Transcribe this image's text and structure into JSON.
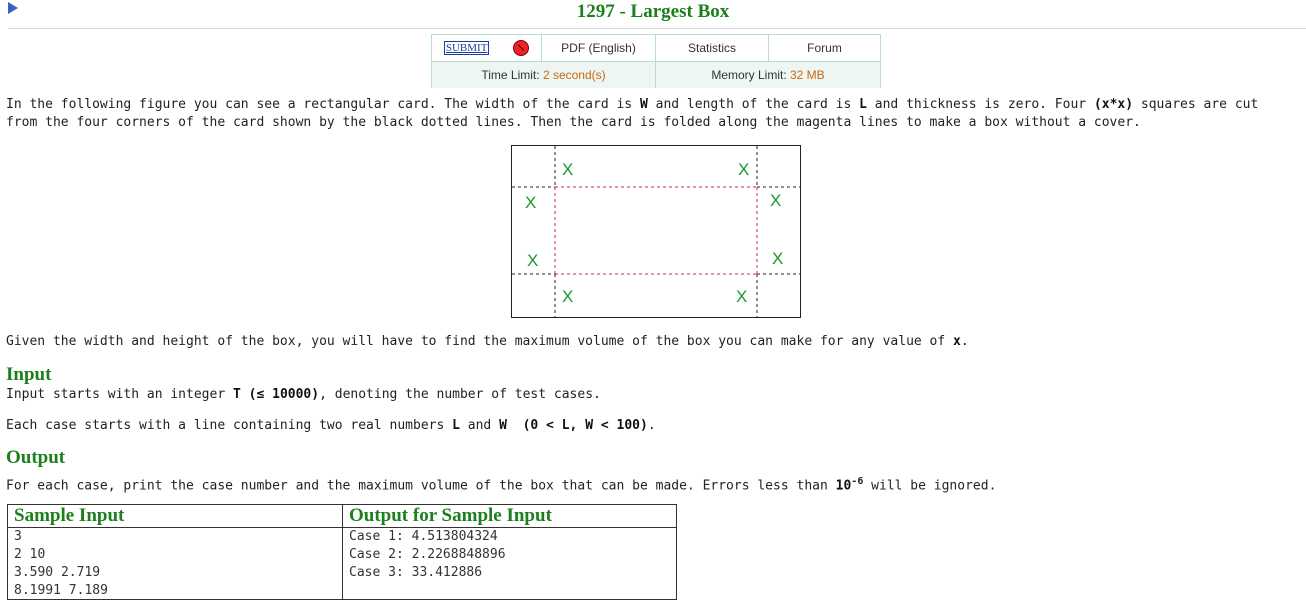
{
  "problem": {
    "title": "1297 - Largest Box"
  },
  "info_table": {
    "submit_label": "SUBMIT",
    "pdf_label": "PDF (English)",
    "statistics_label": "Statistics",
    "forum_label": "Forum",
    "time_limit_label": "Time Limit:",
    "time_limit_value": "2 second(s)",
    "memory_limit_label": "Memory Limit:",
    "memory_limit_value": "32 MB"
  },
  "statement": {
    "p1_a": "In the following figure you can see a rectangular card. The width of the card is ",
    "p1_W": "W",
    "p1_b": " and length of the card is ",
    "p1_L": "L",
    "p1_c": " and thickness is zero. Four ",
    "p1_x": "(x*x)",
    "p1_d": " squares are cut",
    "p1_line2": "from the four corners of the card shown by the black dotted lines. Then the card is folded along the magenta lines to make a box without a cover.",
    "p2_a": "Given the width and height of the box, you will have to find the maximum volume of the box you can make for any value of ",
    "p2_x": "x",
    "p2_b": "."
  },
  "figure": {
    "marks": [
      "X",
      "X",
      "X",
      "X",
      "X",
      "X",
      "X",
      "X"
    ]
  },
  "input_section": {
    "heading": "Input",
    "line1_a": "Input starts with an integer ",
    "line1_T": "T",
    "line1_b": " (",
    "line1_le": "≤",
    "line1_c": " 10000)",
    "line1_d": ", denoting the number of test cases.",
    "line2_a": "Each case starts with a line containing two real numbers ",
    "line2_L": "L",
    "line2_b": " and ",
    "line2_W": "W",
    "line2_c": " (0 < L, W < 100)",
    "line2_d": "."
  },
  "output_section": {
    "heading": "Output",
    "line1_a": "For each case, print the case number and the maximum volume of the box that can be made. Errors less than ",
    "line1_base": "10",
    "line1_exp": "-6",
    "line1_b": " will be ignored."
  },
  "sample": {
    "input_header": "Sample Input",
    "output_header": "Output for Sample Input",
    "input_lines": [
      "3",
      "2 10",
      "3.590 2.719",
      "8.1991 7.189"
    ],
    "output_lines": [
      "Case 1: 4.513804324",
      "Case 2: 2.2268848896",
      "Case 3: 33.412886"
    ]
  },
  "colors": {
    "heading_green": "#1b7f1b",
    "limit_orange": "#c76a10",
    "fold_magenta": "#c0304a",
    "mark_green": "#1b9a2a"
  }
}
